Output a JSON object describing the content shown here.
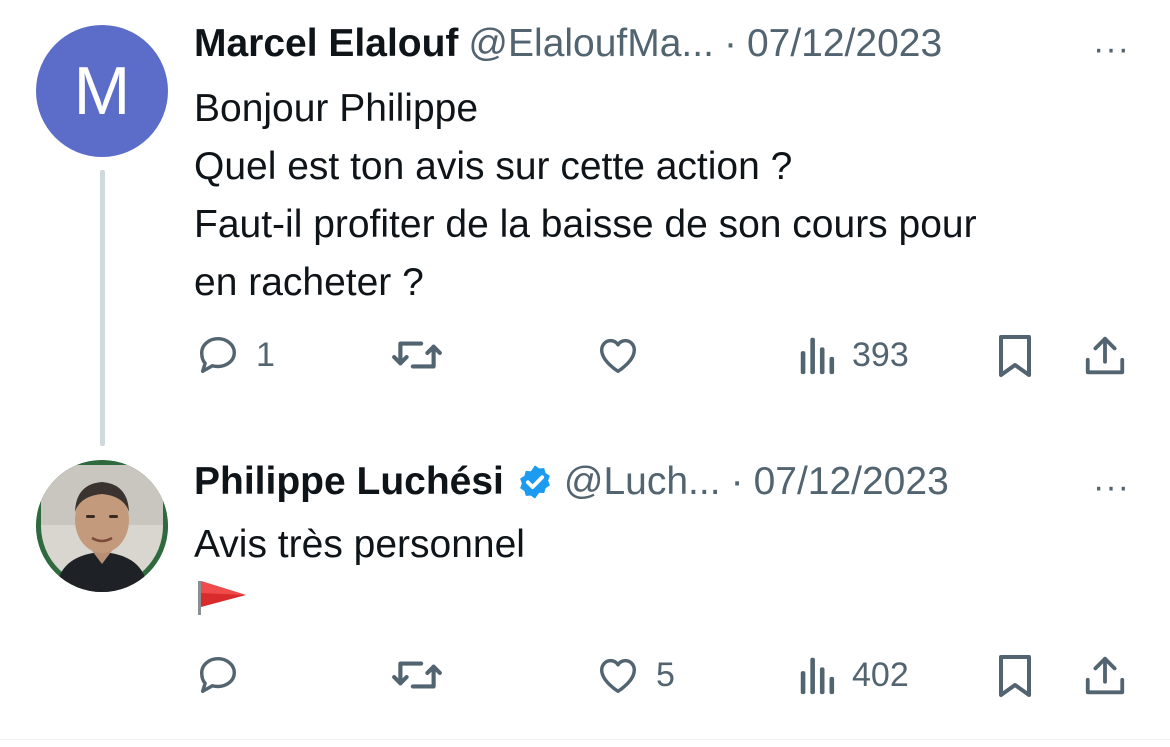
{
  "tweets": [
    {
      "avatar_letter": "M",
      "avatar_color": "#5b6dc8",
      "name": "Marcel Elalouf",
      "handle": "@ElaloufMa...",
      "separator": "·",
      "date": "07/12/2023",
      "more": "···",
      "lines": [
        "Bonjour Philippe",
        "Quel est ton avis sur cette action ?",
        "Faut-il profiter de la baisse de son cours pour",
        "en racheter ?"
      ],
      "replies": "1",
      "retweets": "",
      "likes": "",
      "views": "393"
    },
    {
      "name": "Philippe Luchési",
      "verified": true,
      "handle": "@Luch...",
      "separator": "·",
      "date": "07/12/2023",
      "more": "···",
      "lines": [
        "Avis très personnel"
      ],
      "emoji": "red-triangular-flag",
      "replies": "",
      "retweets": "",
      "likes": "5",
      "views": "402"
    }
  ],
  "colors": {
    "text": "#0f1419",
    "muted": "#536471",
    "verified_blue": "#1d9bf0",
    "thread_line": "#cfd9de"
  }
}
